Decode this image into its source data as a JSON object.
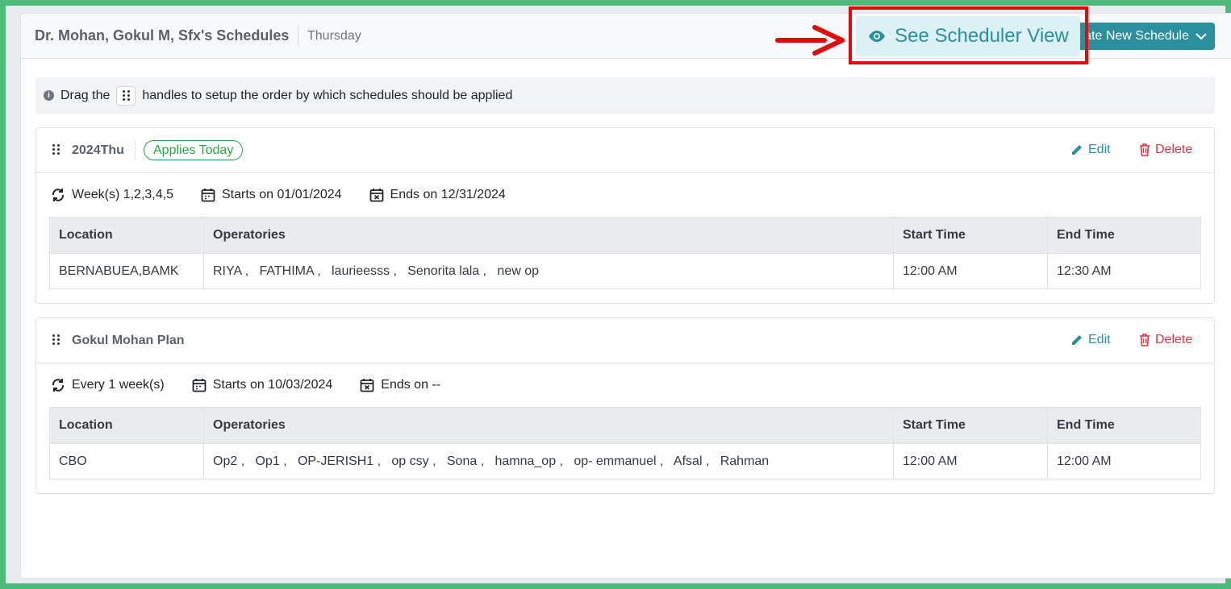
{
  "header": {
    "title": "Dr. Mohan, Gokul M, Sfx's Schedules",
    "day": "Thursday",
    "create_label": "ate New Schedule",
    "scheduler_view_label": "See Scheduler View"
  },
  "info": {
    "prefix": "Drag the",
    "suffix": "handles to setup the order by which schedules should be applied"
  },
  "actions": {
    "edit": "Edit",
    "delete": "Delete"
  },
  "table_headers": {
    "location": "Location",
    "operatories": "Operatories",
    "start": "Start Time",
    "end": "End Time"
  },
  "schedules": [
    {
      "name": "2024Thu",
      "badge": "Applies Today",
      "recurrence": "Week(s) 1,2,3,4,5",
      "starts": "Starts on 01/01/2024",
      "ends": "Ends on 12/31/2024",
      "row": {
        "location": "BERNABUEA,BAMK",
        "operatories": "RIYA ,   FATHIMA ,   laurieesss ,   Senorita lala ,   new op",
        "start": "12:00 AM",
        "end": "12:30 AM"
      }
    },
    {
      "name": "Gokul Mohan Plan",
      "recurrence": "Every 1 week(s)",
      "starts": "Starts on 10/03/2024",
      "ends": "Ends on --",
      "row": {
        "location": "CBO",
        "operatories": "Op2 ,   Op1 ,   OP-JERISH1 ,   op csy ,   Sona ,   hamna_op ,   op- emmanuel ,   Afsal ,   Rahman",
        "start": "12:00 AM",
        "end": "12:00 AM"
      }
    }
  ],
  "colors": {
    "accent": "#2b8f9e",
    "danger": "#dc3545",
    "success": "#28a745",
    "highlight": "#e00b0b",
    "frame": "#4cbb7a"
  }
}
